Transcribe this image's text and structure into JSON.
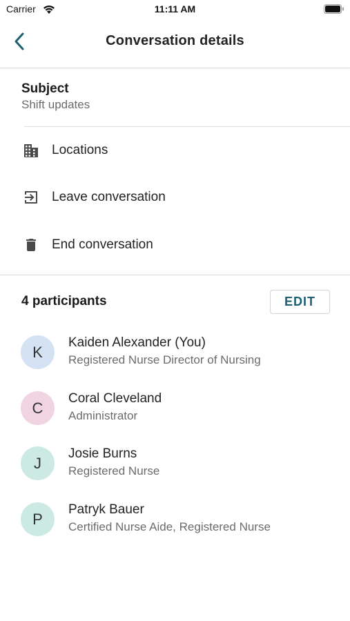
{
  "status_bar": {
    "carrier": "Carrier",
    "time": "11:11 AM"
  },
  "nav": {
    "title": "Conversation details",
    "back_icon": "chevron-left-icon"
  },
  "subject": {
    "label": "Subject",
    "value": "Shift updates"
  },
  "actions": [
    {
      "label": "Locations",
      "icon": "building-icon"
    },
    {
      "label": "Leave conversation",
      "icon": "exit-icon"
    },
    {
      "label": "End conversation",
      "icon": "trash-icon"
    }
  ],
  "participants": {
    "count_label": "4 participants",
    "edit_label": "EDIT",
    "list": [
      {
        "initial": "K",
        "name": "Kaiden Alexander (You)",
        "role": "Registered Nurse Director of Nursing",
        "avatar_color": "#d4e2f4"
      },
      {
        "initial": "C",
        "name": "Coral Cleveland",
        "role": "Administrator",
        "avatar_color": "#f0d4e2"
      },
      {
        "initial": "J",
        "name": "Josie Burns",
        "role": "Registered Nurse",
        "avatar_color": "#cde9e4"
      },
      {
        "initial": "P",
        "name": "Patryk Bauer",
        "role": "Certified Nurse Aide, Registered Nurse",
        "avatar_color": "#cde9e4"
      }
    ]
  },
  "colors": {
    "accent": "#1c5f73",
    "icon": "#4a4a4a"
  }
}
